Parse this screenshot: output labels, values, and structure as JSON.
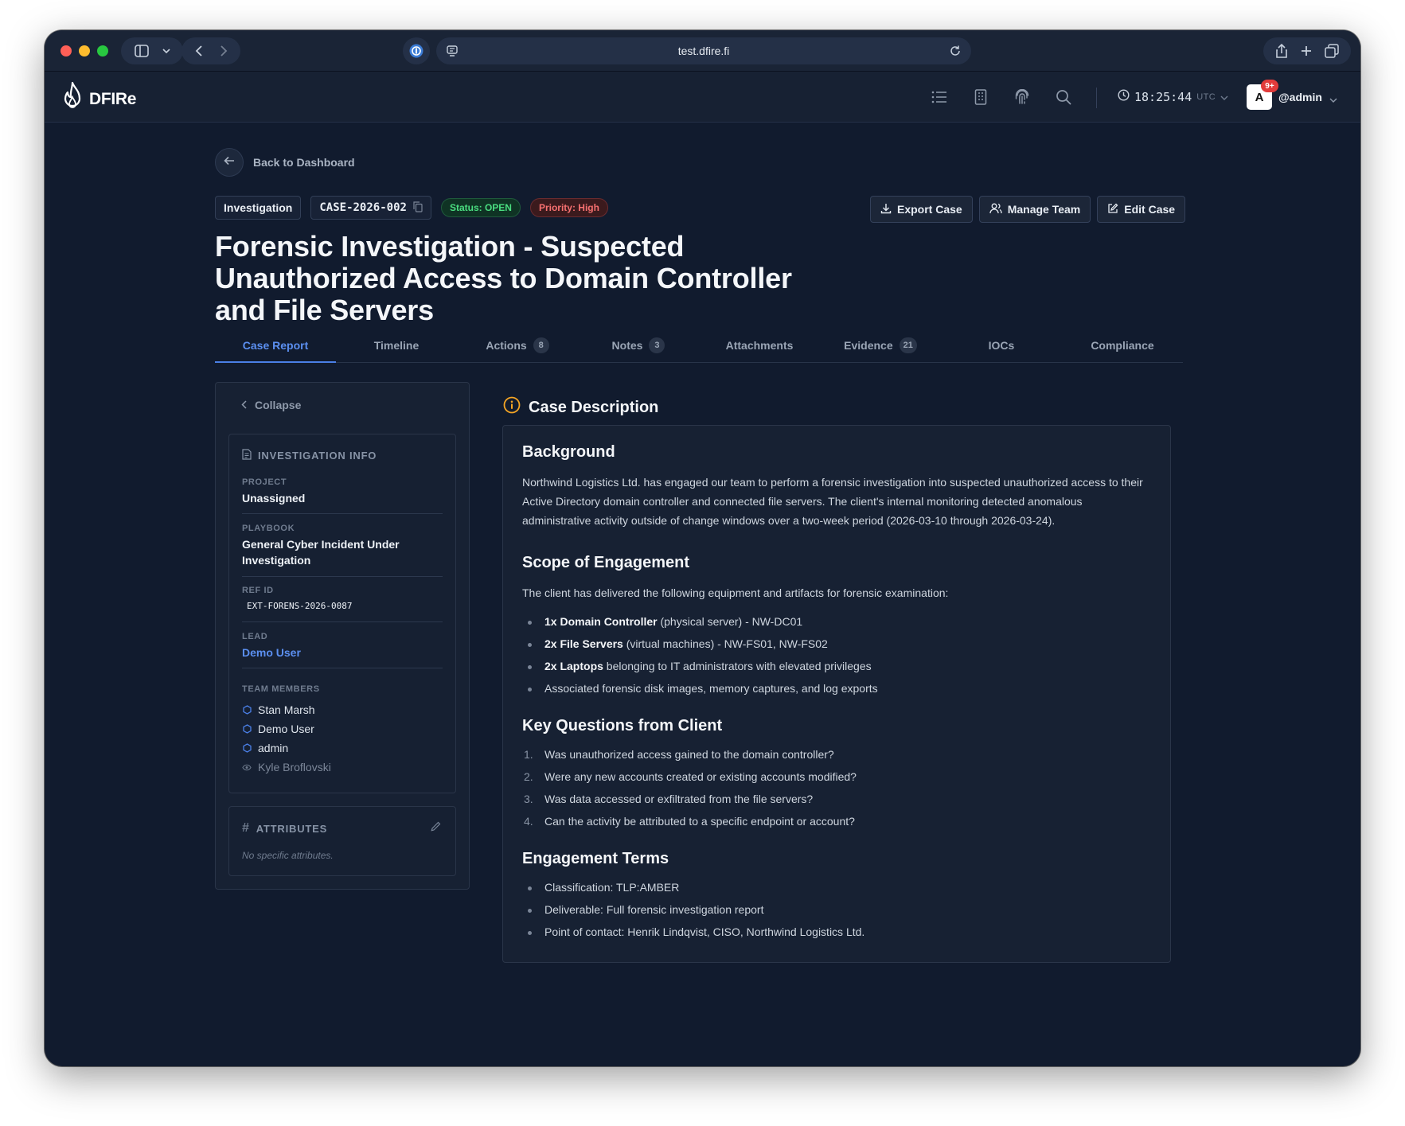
{
  "browser": {
    "url": "test.dfire.fi"
  },
  "app": {
    "logo_text": "DFIRe",
    "clock_time": "18:25:44",
    "clock_tz": "UTC",
    "avatar_initial": "A",
    "notification_badge": "9+",
    "user_name": "@admin"
  },
  "case": {
    "back_label": "Back to Dashboard",
    "type_label": "Investigation",
    "case_id": "CASE-2026-002",
    "status": "Status: OPEN",
    "priority": "Priority: High",
    "title": "Forensic Investigation - Suspected Unauthorized Access to Domain Controller and File Servers",
    "actions": {
      "export": "Export Case",
      "manage_team": "Manage Team",
      "edit": "Edit Case"
    }
  },
  "tabs": [
    {
      "label": "Case Report",
      "count": null
    },
    {
      "label": "Timeline",
      "count": null
    },
    {
      "label": "Actions",
      "count": "8"
    },
    {
      "label": "Notes",
      "count": "3"
    },
    {
      "label": "Attachments",
      "count": null
    },
    {
      "label": "Evidence",
      "count": "21"
    },
    {
      "label": "IOCs",
      "count": null
    },
    {
      "label": "Compliance",
      "count": null
    }
  ],
  "sidebar": {
    "collapse_label": "Collapse",
    "info_title": "INVESTIGATION INFO",
    "project_label": "PROJECT",
    "project_value": "Unassigned",
    "playbook_label": "PLAYBOOK",
    "playbook_value": "General Cyber Incident Under Investigation",
    "ref_label": "REF ID",
    "ref_value": "EXT-FORENS-2026-0087",
    "lead_label": "LEAD",
    "lead_value": "Demo User",
    "members_label": "TEAM MEMBERS",
    "members": [
      {
        "name": "Stan Marsh",
        "role": "member"
      },
      {
        "name": "Demo User",
        "role": "member"
      },
      {
        "name": "admin",
        "role": "member"
      },
      {
        "name": "Kyle Broflovski",
        "role": "viewer"
      }
    ],
    "attributes_title": "ATTRIBUTES",
    "attributes_empty": "No specific attributes."
  },
  "description": {
    "heading": "Case Description",
    "background_title": "Background",
    "background_text": "Northwind Logistics Ltd. has engaged our team to perform a forensic investigation into suspected unauthorized access to their Active Directory domain controller and connected file servers. The client's internal monitoring detected anomalous administrative activity outside of change windows over a two-week period (2026-03-10 through 2026-03-24).",
    "scope_title": "Scope of Engagement",
    "scope_intro": "The client has delivered the following equipment and artifacts for forensic examination:",
    "scope_items": [
      {
        "bold": "1x Domain Controller",
        "rest": " (physical server) - NW-DC01"
      },
      {
        "bold": "2x File Servers",
        "rest": " (virtual machines) - NW-FS01, NW-FS02"
      },
      {
        "bold": "2x Laptops",
        "rest": " belonging to IT administrators with elevated privileges"
      },
      {
        "bold": "",
        "rest": "Associated forensic disk images, memory captures, and log exports"
      }
    ],
    "questions_title": "Key Questions from Client",
    "questions": [
      {
        "num": "1.",
        "text": "Was unauthorized access gained to the domain controller?"
      },
      {
        "num": "2.",
        "text": "Were any new accounts created or existing accounts modified?"
      },
      {
        "num": "3.",
        "text": "Was data accessed or exfiltrated from the file servers?"
      },
      {
        "num": "4.",
        "text": "Can the activity be attributed to a specific endpoint or account?"
      }
    ],
    "terms_title": "Engagement Terms",
    "terms": [
      "Classification: TLP:AMBER",
      "Deliverable: Full forensic investigation report",
      "Point of contact: Henrik Lindqvist, CISO, Northwind Logistics Ltd."
    ]
  },
  "colors": {
    "accent": "#4a7fe6",
    "background": "#111b2e",
    "status_open": "#4ade80",
    "priority_high": "#f87171",
    "info_icon": "#f5a524"
  }
}
